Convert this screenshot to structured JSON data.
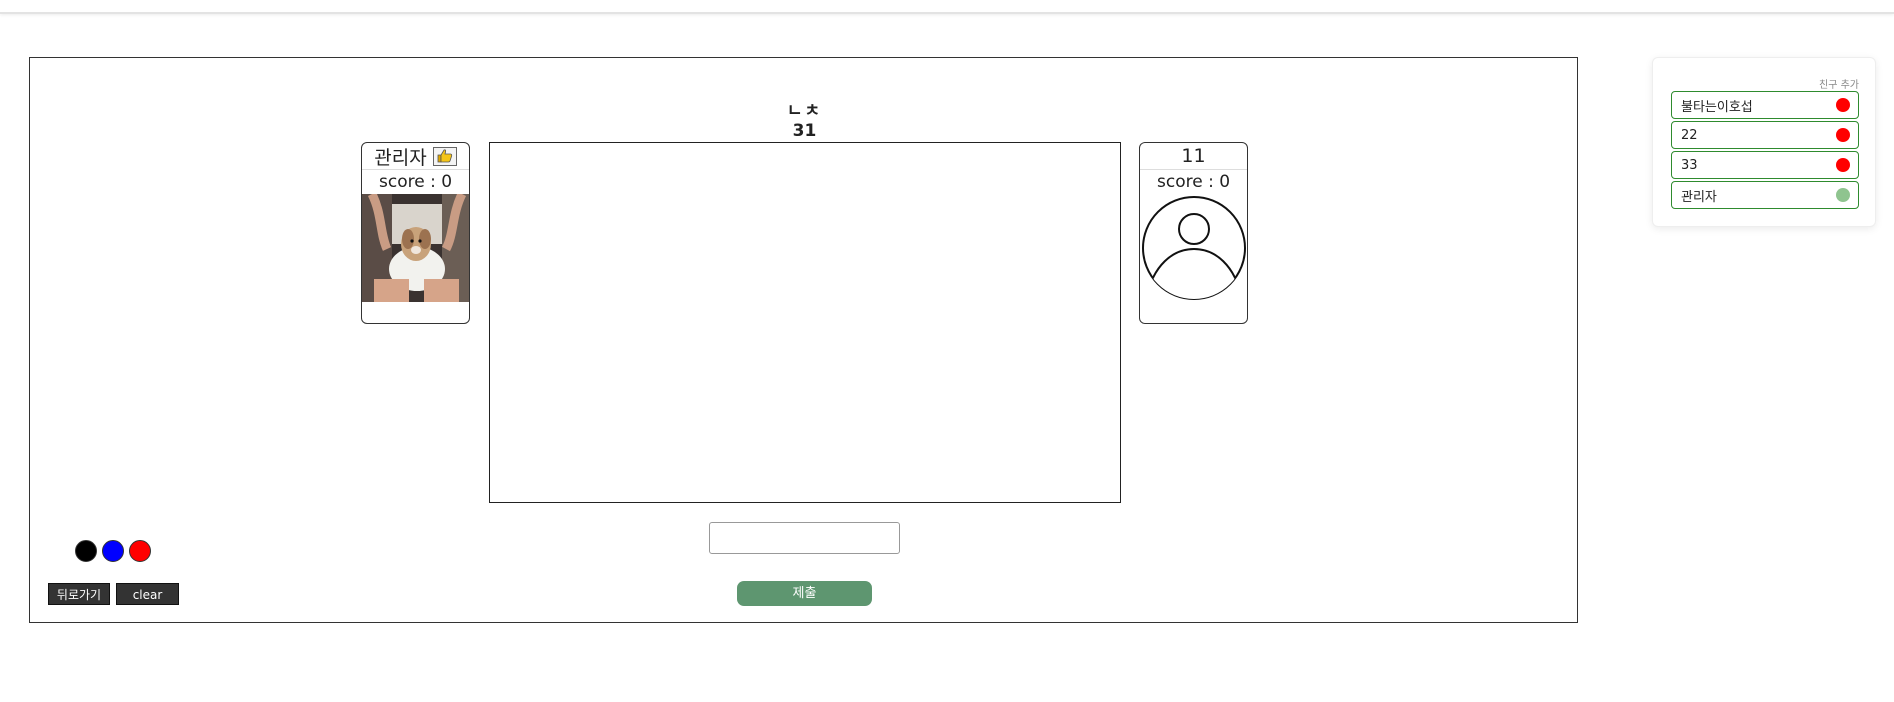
{
  "game": {
    "hint": "ㄴㅊ",
    "timer": "31"
  },
  "players": [
    {
      "name": "관리자",
      "score_label": "score : 0",
      "like_icon": "thumbs-up-icon",
      "media": "camera-feed-dog-photo"
    },
    {
      "name": "11",
      "score_label": "score : 0",
      "media": "default-avatar-icon"
    }
  ],
  "answer": {
    "value": "",
    "placeholder": ""
  },
  "submit_label": "제출",
  "palette": {
    "colors": [
      "#000000",
      "#0000ff",
      "#ff0000"
    ]
  },
  "controls": {
    "back_label": "뒤로가기",
    "clear_label": "clear"
  },
  "friends": {
    "add_label": "친구 추가",
    "items": [
      {
        "name": "불타는이호섭",
        "status": "offline",
        "status_color": "#ff0000"
      },
      {
        "name": "22",
        "status": "offline",
        "status_color": "#ff0000"
      },
      {
        "name": "33",
        "status": "offline",
        "status_color": "#ff0000"
      },
      {
        "name": "관리자",
        "status": "online",
        "status_color": "#8fc48f"
      }
    ]
  }
}
